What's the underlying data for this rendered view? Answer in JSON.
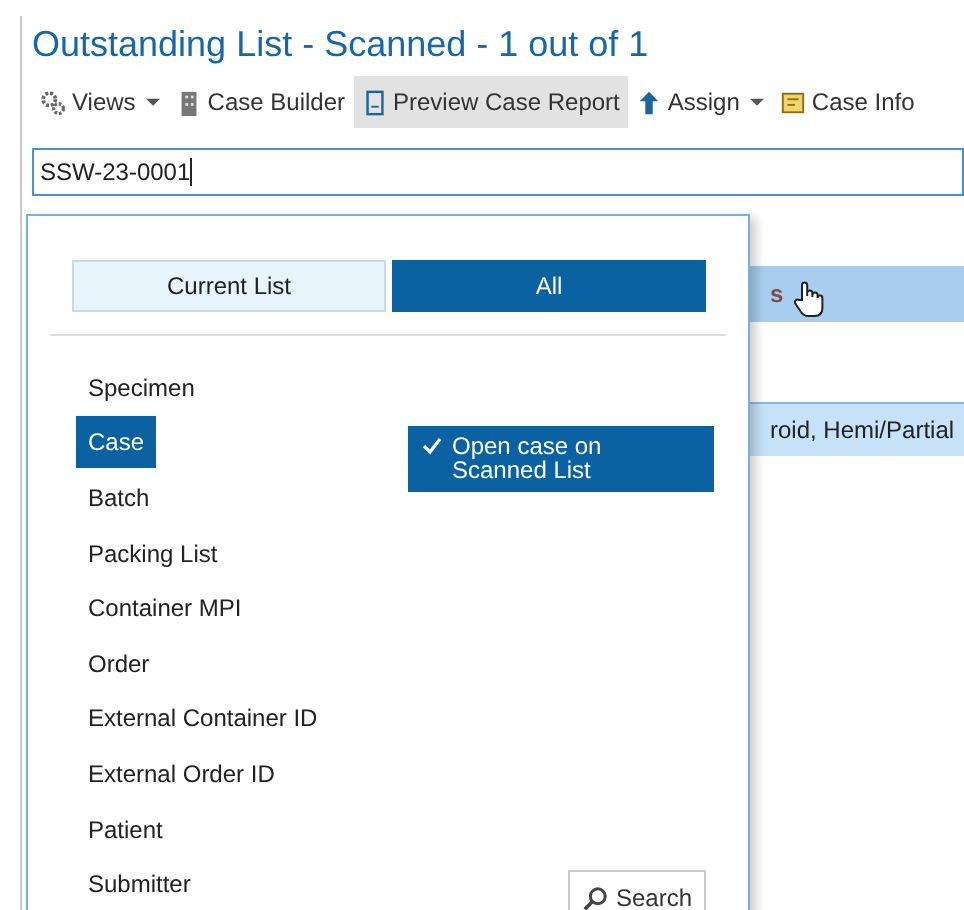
{
  "window": {
    "title": "Outstanding List - Scanned - 1 out of 1"
  },
  "toolbar": [
    {
      "label": "Views",
      "kind": "menu",
      "selected": false
    },
    {
      "label": "Case Builder",
      "kind": "button",
      "selected": false
    },
    {
      "label": "Preview Case Report",
      "kind": "button",
      "selected": true
    },
    {
      "label": "Assign",
      "kind": "menu",
      "selected": false
    },
    {
      "label": "Case Info",
      "kind": "button",
      "selected": false
    }
  ],
  "scan_field": {
    "value": "SSW-23-0001"
  },
  "background_rows": [
    {
      "text": "s",
      "kind": "header"
    },
    {
      "text": "roid, Hemi/Partial",
      "kind": "row"
    }
  ],
  "popup": {
    "tabs": [
      {
        "label": "Current List",
        "selected": false
      },
      {
        "label": "All",
        "selected": true
      }
    ],
    "search_types": [
      {
        "label": "Specimen",
        "selected": false
      },
      {
        "label": "Case",
        "selected": true
      },
      {
        "label": "Batch",
        "selected": false
      },
      {
        "label": "Packing List",
        "selected": false
      },
      {
        "label": "Container MPI",
        "selected": false
      },
      {
        "label": "Order",
        "selected": false
      },
      {
        "label": "External Container ID",
        "selected": false
      },
      {
        "label": "External Order ID",
        "selected": false
      },
      {
        "label": "Patient",
        "selected": false
      },
      {
        "label": "Submitter",
        "selected": false
      }
    ],
    "option": {
      "label": "Open case on Scanned List",
      "checked": true
    },
    "search_button": "Search"
  }
}
